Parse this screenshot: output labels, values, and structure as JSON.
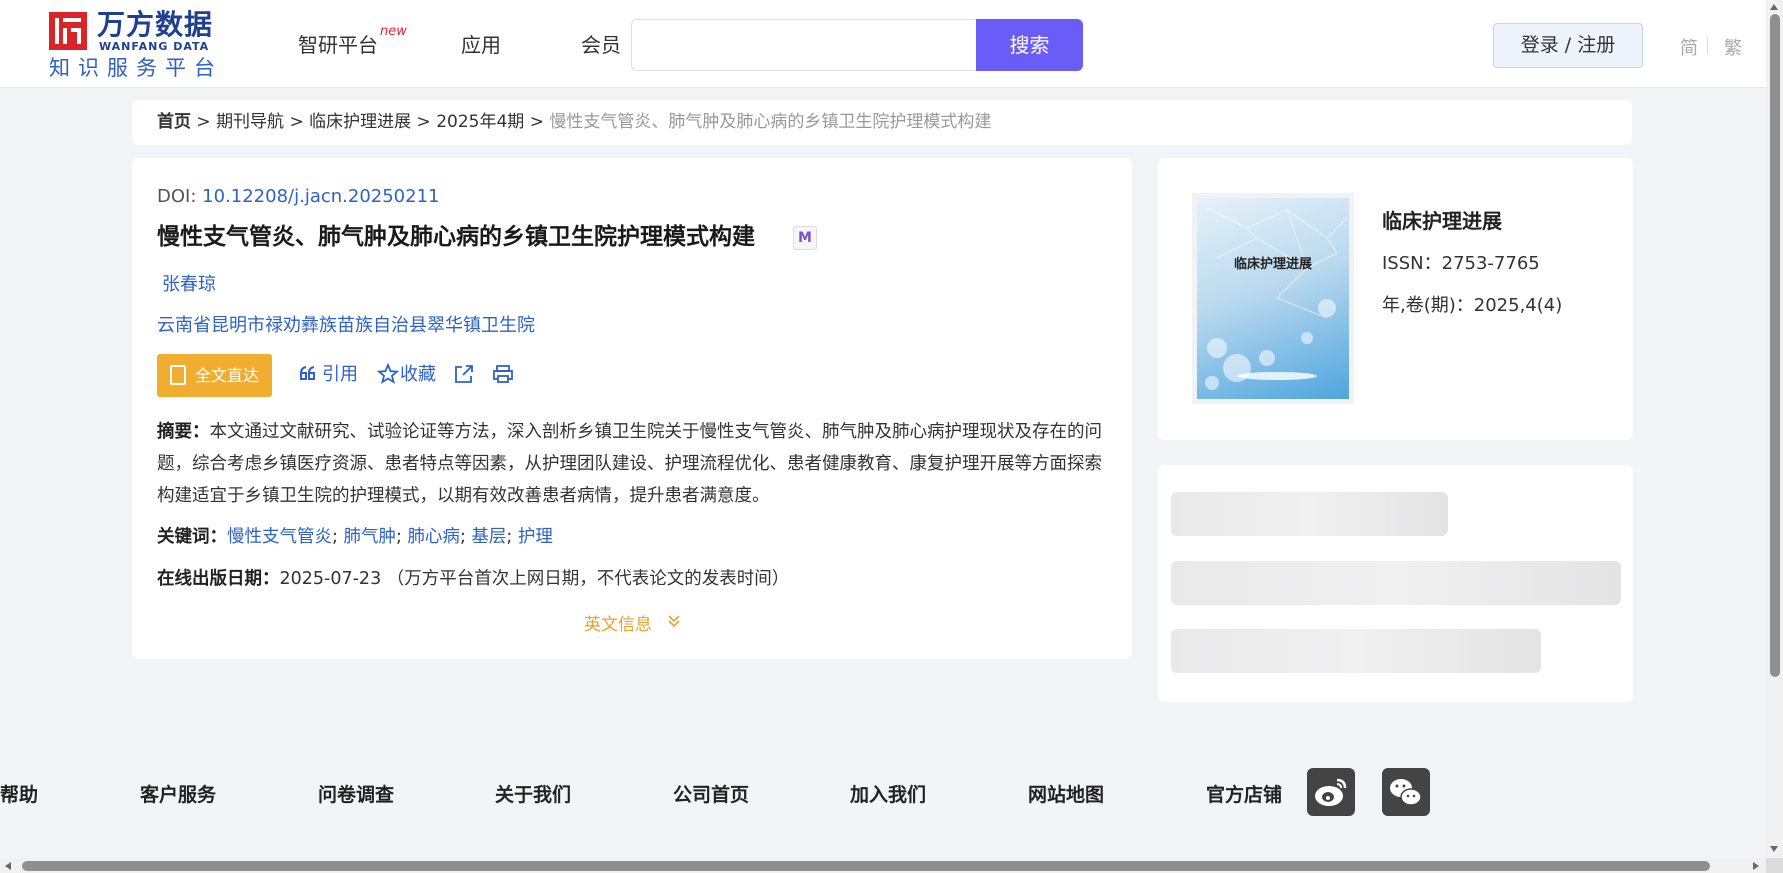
{
  "header": {
    "logo_cn": "万方数据",
    "logo_en": "WANFANG DATA",
    "logo_sub": "知识服务平台",
    "nav": [
      {
        "label": "智研平台"
      },
      {
        "label": "应用"
      },
      {
        "label": "会员"
      }
    ],
    "nav_new_badge": "new",
    "search_placeholder": "",
    "search_label": "搜索",
    "login_label": "登录 / 注册",
    "lang_simplified": "简",
    "lang_traditional": "繁"
  },
  "breadcrumb": {
    "home": "首页",
    "items": [
      "期刊导航",
      "临床护理进展",
      "2025年4期"
    ],
    "current": "慢性支气管炎、肺气肿及肺心病的乡镇卫生院护理模式构建",
    "separator": ">"
  },
  "article": {
    "doi_label": "DOI:",
    "doi": "10.12208/j.jacn.20250211",
    "title": "慢性支气管炎、肺气肿及肺心病的乡镇卫生院护理模式构建",
    "badge": "M",
    "author": "张春琼",
    "organization": "云南省昆明市禄劝彝族苗族自治县翠华镇卫生院",
    "fulltext_label": "全文直达",
    "cite_label": "引用",
    "favorite_label": "收藏",
    "abstract_label": "摘要：",
    "abstract": "本文通过文献研究、试验论证等方法，深入剖析乡镇卫生院关于慢性支气管炎、肺气肿及肺心病护理现状及存在的问题，综合考虑乡镇医疗资源、患者特点等因素，从护理团队建设、护理流程优化、患者健康教育、康复护理开展等方面探索构建适宜于乡镇卫生院的护理模式，以期有效改善患者病情，提升患者满意度。",
    "keywords_label": "关键词：",
    "keywords": [
      "慢性支气管炎",
      "肺气肿",
      "肺心病",
      "基层",
      "护理"
    ],
    "pubdate_label": "在线出版日期：",
    "pubdate": "2025-07-23",
    "pubdate_note": "（万方平台首次上网日期，不代表论文的发表时间）",
    "english_info_label": "英文信息"
  },
  "journal": {
    "cover_title": "临床护理进展",
    "name": "临床护理进展",
    "issn": "ISSN：2753-7765",
    "volume": "年,卷(期)：2025,4(4)"
  },
  "footer": {
    "links": [
      "帮助",
      "客户服务",
      "问卷调查",
      "关于我们",
      "公司首页",
      "加入我们",
      "网站地图",
      "官方店铺"
    ]
  },
  "colors": {
    "accent": "#6a5cf6",
    "link": "#2e62c8",
    "brand_red": "#d9252a",
    "fulltext": "#f0ad2f"
  }
}
